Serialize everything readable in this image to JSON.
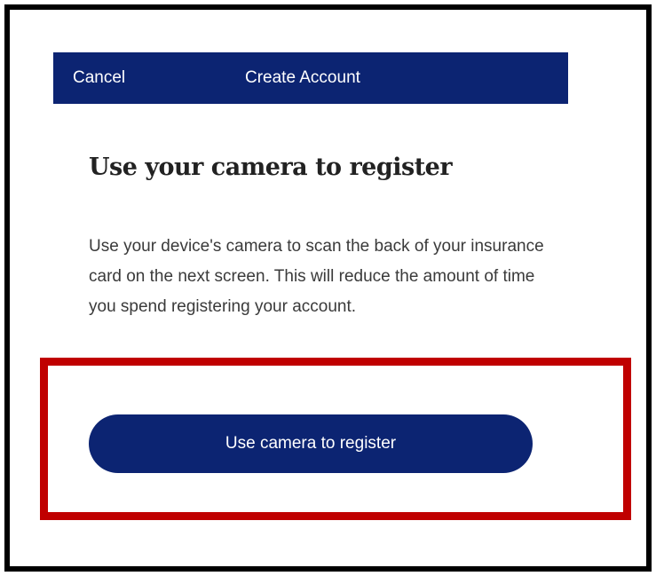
{
  "header": {
    "cancel_label": "Cancel",
    "title": "Create Account"
  },
  "main": {
    "heading": "Use your camera to register",
    "description": "Use your device's camera to scan the back of your insurance card on the next screen. This will reduce the amount of time you spend registering your account.",
    "primary_button_label": "Use camera to register"
  },
  "colors": {
    "brand_navy": "#0c2472",
    "highlight_red": "#c00000"
  }
}
